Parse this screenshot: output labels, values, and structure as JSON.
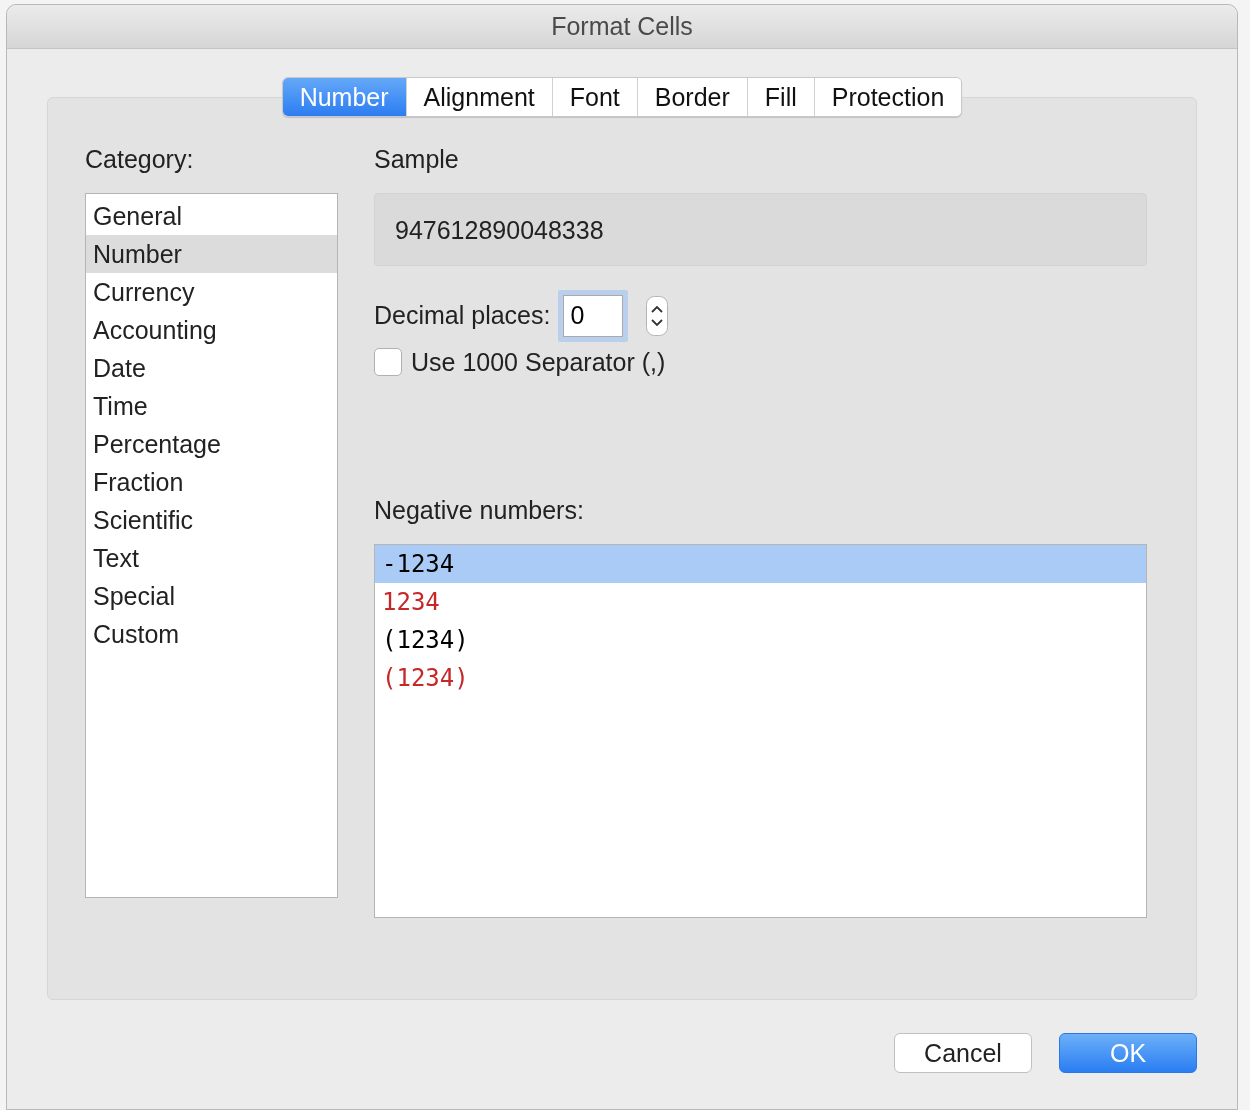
{
  "window": {
    "title": "Format Cells"
  },
  "tabs": [
    {
      "label": "Number",
      "selected": true
    },
    {
      "label": "Alignment",
      "selected": false
    },
    {
      "label": "Font",
      "selected": false
    },
    {
      "label": "Border",
      "selected": false
    },
    {
      "label": "Fill",
      "selected": false
    },
    {
      "label": "Protection",
      "selected": false
    }
  ],
  "category": {
    "label": "Category:",
    "items": [
      {
        "label": "General",
        "selected": false
      },
      {
        "label": "Number",
        "selected": true
      },
      {
        "label": "Currency",
        "selected": false
      },
      {
        "label": "Accounting",
        "selected": false
      },
      {
        "label": "Date",
        "selected": false
      },
      {
        "label": "Time",
        "selected": false
      },
      {
        "label": "Percentage",
        "selected": false
      },
      {
        "label": "Fraction",
        "selected": false
      },
      {
        "label": "Scientific",
        "selected": false
      },
      {
        "label": "Text",
        "selected": false
      },
      {
        "label": "Special",
        "selected": false
      },
      {
        "label": "Custom",
        "selected": false
      }
    ]
  },
  "sample": {
    "label": "Sample",
    "value": "947612890048338"
  },
  "decimal_places": {
    "label": "Decimal places:",
    "value": "0"
  },
  "separator": {
    "label": "Use 1000 Separator (,)",
    "checked": false
  },
  "negative_numbers": {
    "label": "Negative numbers:",
    "items": [
      {
        "label": "-1234",
        "color": "#000000",
        "selected": true
      },
      {
        "label": "1234",
        "color": "#c62828",
        "selected": false
      },
      {
        "label": "(1234)",
        "color": "#000000",
        "selected": false
      },
      {
        "label": "(1234)",
        "color": "#c62828",
        "selected": false
      }
    ]
  },
  "buttons": [
    {
      "label": "Cancel",
      "kind": "secondary"
    },
    {
      "label": "OK",
      "kind": "primary"
    }
  ]
}
